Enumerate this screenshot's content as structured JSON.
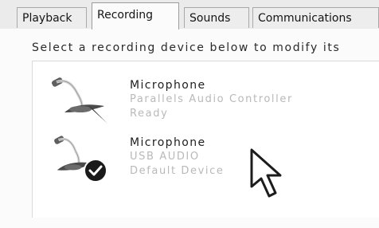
{
  "tabs": [
    {
      "label": "Playback",
      "active": false
    },
    {
      "label": "Recording",
      "active": true
    },
    {
      "label": "Sounds",
      "active": false
    },
    {
      "label": "Communications",
      "active": false
    }
  ],
  "instruction": "Select a recording device below to modify its",
  "devices": [
    {
      "name": "Microphone",
      "driver": "Parallels Audio Controller",
      "status": "Ready",
      "icon": "microphone-icon",
      "is_default": false
    },
    {
      "name": "Microphone",
      "driver": "USB AUDIO",
      "status": "Default Device",
      "icon": "microphone-icon",
      "is_default": true
    }
  ],
  "badge_icon": "checkmark-icon",
  "cursor_icon": "mouse-pointer-icon"
}
